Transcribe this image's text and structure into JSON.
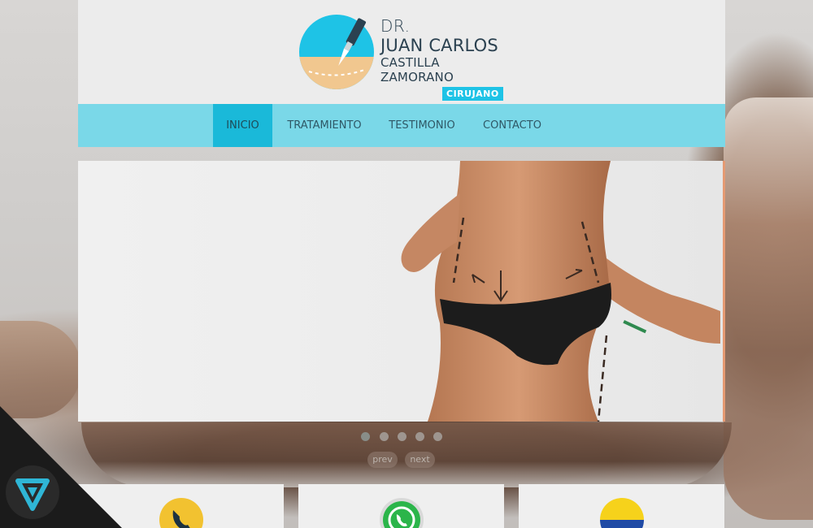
{
  "logo": {
    "dr": "DR.",
    "name_line1": "JUAN CARLOS",
    "name_line2": "CASTILLA ZAMORANO",
    "badge": "CIRUJANO"
  },
  "nav": {
    "items": [
      {
        "label": "INICIO",
        "active": true
      },
      {
        "label": "TRATAMIENTO",
        "active": false
      },
      {
        "label": "TESTIMONIO",
        "active": false
      },
      {
        "label": "CONTACTO",
        "active": false
      }
    ]
  },
  "slider": {
    "slide_count": 5,
    "active_slide": 1,
    "prev_label": "prev",
    "next_label": "next"
  },
  "cards": [
    {
      "icon": "phone-icon"
    },
    {
      "icon": "whatsapp-icon"
    },
    {
      "icon": "colombia-flag-icon"
    }
  ],
  "colors": {
    "accent": "#1ec3e6",
    "nav_bg": "#7ad8e8",
    "nav_active": "#1ab9d9",
    "logo_text": "#2b4150",
    "phone_yellow": "#f2c230",
    "whatsapp_green": "#2bb54a"
  }
}
